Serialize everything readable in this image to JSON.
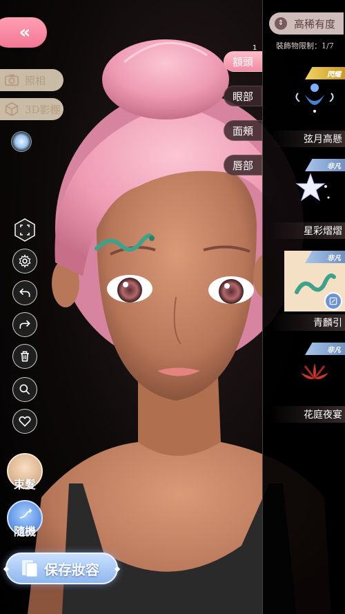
{
  "top": {
    "back_glyph": "«",
    "back_icon": "double-chevron-left-icon"
  },
  "left_pills": [
    {
      "label": "照相",
      "icon": "camera-icon"
    },
    {
      "label": "3D影棚",
      "icon": "cube-icon"
    }
  ],
  "tools": [
    {
      "name": "fullscreen",
      "icon": "fullscreen-icon"
    },
    {
      "name": "settings",
      "icon": "gear-icon"
    },
    {
      "name": "undo",
      "icon": "undo-icon"
    },
    {
      "name": "redo",
      "icon": "redo-icon"
    },
    {
      "name": "delete",
      "icon": "trash-icon"
    },
    {
      "name": "zoom",
      "icon": "search-icon"
    },
    {
      "name": "favorite",
      "icon": "heart-icon"
    }
  ],
  "bottom_buttons": {
    "hair_bun": "束髮",
    "random": "隨機",
    "save": "保存妝容"
  },
  "panel": {
    "sort_label": "高稀有度",
    "limit_label": "裝飾物限制：1/7",
    "tabs": [
      {
        "label": "額頭",
        "active": true,
        "badge": "1"
      },
      {
        "label": "眼部",
        "active": false
      },
      {
        "label": "面頰",
        "active": false
      },
      {
        "label": "唇部",
        "active": false
      }
    ],
    "items": [
      {
        "name": "弦月高懸",
        "rarity": "閃耀",
        "tag_color": "gold",
        "selected": false
      },
      {
        "name": "星彩熠熠",
        "rarity": "非凡",
        "tag_color": "blue",
        "selected": false
      },
      {
        "name": "青麟引",
        "rarity": "非凡",
        "tag_color": "blue",
        "selected": true
      },
      {
        "name": "花庭夜宴",
        "rarity": "非凡",
        "tag_color": "blue",
        "selected": false
      }
    ]
  },
  "colors": {
    "accent_pink": "#f27795",
    "hair_pink": "#f2a3bb",
    "skin": "#c9896a",
    "panel_bg": "#000000"
  }
}
